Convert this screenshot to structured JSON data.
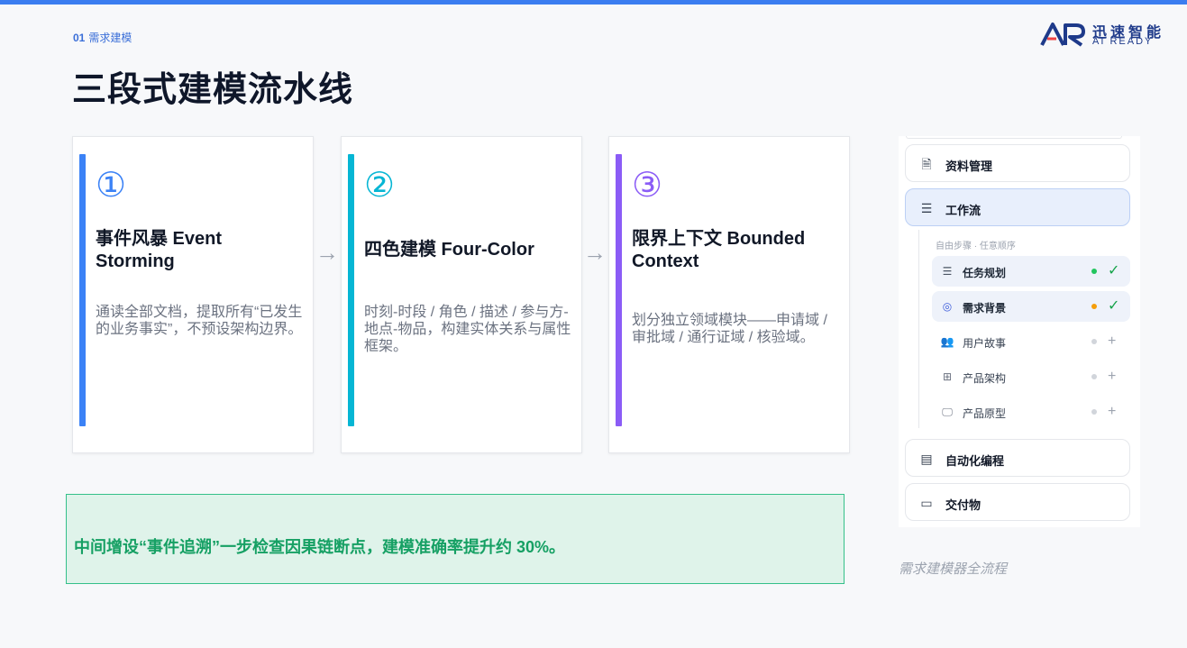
{
  "header": {
    "section_num": "01",
    "section_label": "需求建模",
    "title": "三段式建模流水线",
    "logo_cn": "迅速智能",
    "logo_en": "AI READY",
    "logo_icon": "ar-logo-icon"
  },
  "colors": {
    "primary": "#3b7df0",
    "card1_accent": "#3b82f6",
    "card2_accent": "#06b6d4",
    "card3_accent": "#8b5cf6",
    "callout_text": "#16a064",
    "callout_bg": "#dff3ea"
  },
  "cards": [
    {
      "circled_num": "①",
      "title": "事件风暴 Event Storming",
      "desc": "通读全部文档，提取所有“已发生的业务事实”，不预设架构边界。"
    },
    {
      "circled_num": "②",
      "title": "四色建模 Four-Color",
      "desc": "时刻-时段 / 角色 / 描述 / 参与方-地点-物品，构建实体关系与属性框架。"
    },
    {
      "circled_num": "③",
      "title": "限界上下文 Bounded Context",
      "desc": "划分独立领域模块——申请域 / 审批域 / 通行证域 / 核验域。"
    }
  ],
  "arrow_glyph": "→",
  "callout": "中间增设“事件追溯”一步检查因果链断点，建模准确率提升约 30%。",
  "sidebar": {
    "items": [
      {
        "label": "资料管理",
        "icon": "document-icon",
        "glyph": "🗎"
      },
      {
        "label": "工作流",
        "icon": "list-icon",
        "glyph": "☰"
      },
      {
        "label": "自动化编程",
        "icon": "code-file-icon",
        "glyph": "▤"
      },
      {
        "label": "交付物",
        "icon": "folder-icon",
        "glyph": "▭"
      }
    ],
    "sub_label": "自由步骤 · 任意顺序",
    "sub_items": [
      {
        "label": "任务规划",
        "icon": "list-icon",
        "glyph": "☰",
        "dot_color": "#22c55e",
        "status_glyph": "✓",
        "status_icon": "check-icon"
      },
      {
        "label": "需求背景",
        "icon": "target-icon",
        "glyph": "◎",
        "dot_color": "#f59e0b",
        "status_glyph": "✓",
        "status_icon": "check-icon"
      },
      {
        "label": "用户故事",
        "icon": "users-icon",
        "glyph": "👥",
        "dot_color": "#d1d5db",
        "status_glyph": "+",
        "status_icon": "plus-icon"
      },
      {
        "label": "产品架构",
        "icon": "grid-icon",
        "glyph": "⊞",
        "dot_color": "#d1d5db",
        "status_glyph": "+",
        "status_icon": "plus-icon"
      },
      {
        "label": "产品原型",
        "icon": "monitor-icon",
        "glyph": "🖵",
        "dot_color": "#d1d5db",
        "status_glyph": "+",
        "status_icon": "plus-icon"
      }
    ]
  },
  "caption": "需求建模器全流程"
}
